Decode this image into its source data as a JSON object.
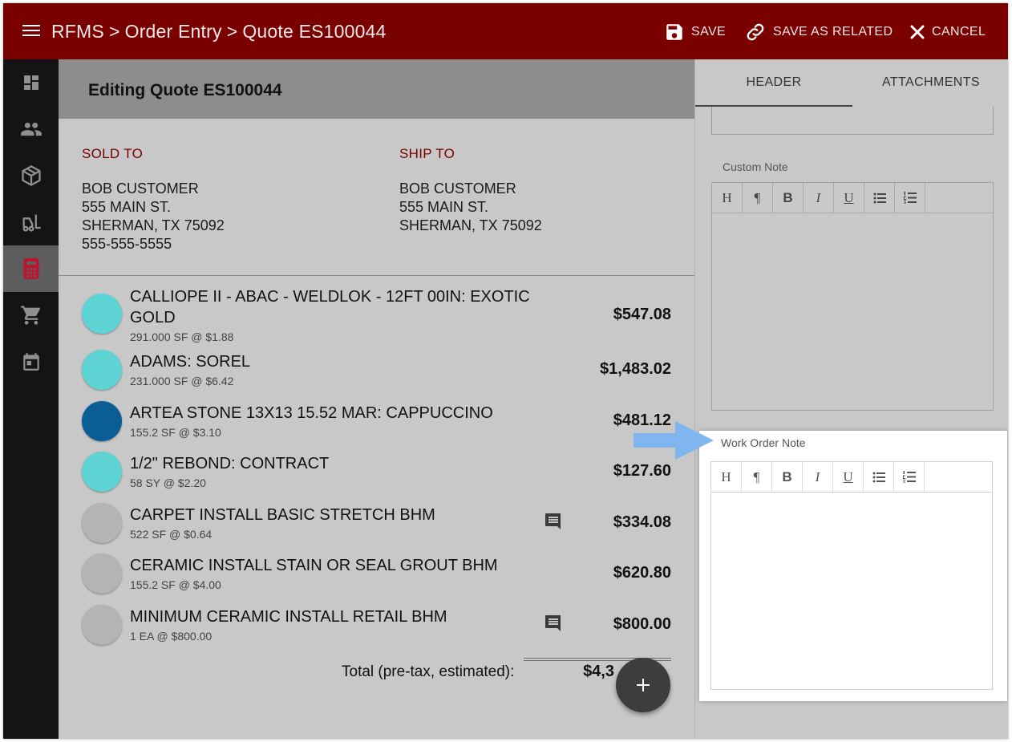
{
  "header": {
    "breadcrumb": [
      "RFMS",
      "Order Entry",
      "Quote ES100044"
    ],
    "breadcrumb_sep": ">",
    "save_label": "SAVE",
    "save_related_label": "SAVE AS RELATED",
    "cancel_label": "CANCEL"
  },
  "sidebar": {
    "items": [
      {
        "icon": "dashboard-icon",
        "active": false
      },
      {
        "icon": "people-icon",
        "active": false
      },
      {
        "icon": "package-icon",
        "active": false
      },
      {
        "icon": "forklift-icon",
        "active": false
      },
      {
        "icon": "calculator-icon",
        "active": true
      },
      {
        "icon": "cart-icon",
        "active": false
      },
      {
        "icon": "calendar-icon",
        "active": false
      }
    ]
  },
  "quote": {
    "title": "Editing Quote ES100044",
    "sold_to_label": "SOLD TO",
    "sold_to": [
      "BOB CUSTOMER",
      "555 MAIN ST.",
      "SHERMAN, TX 75092",
      "555-555-5555"
    ],
    "ship_to_label": "SHIP TO",
    "ship_to": [
      "BOB CUSTOMER",
      "555 MAIN ST.",
      "SHERMAN, TX 75092"
    ],
    "lines": [
      {
        "name": "CALLIOPE II - ABAC - WELDLOK - 12FT 00IN: EXOTIC GOLD",
        "detail": "291.000 SF @ $1.88",
        "price": "$547.08",
        "color": "#5ed3d3",
        "has_note": false
      },
      {
        "name": "ADAMS: SOREL",
        "detail": "231.000 SF @ $6.42",
        "price": "$1,483.02",
        "color": "#5ed3d3",
        "has_note": false
      },
      {
        "name": "ARTEA STONE 13X13 15.52 MAR: CAPPUCCINO",
        "detail": "155.2 SF @ $3.10",
        "price": "$481.12",
        "color": "#0b5d96",
        "has_note": false
      },
      {
        "name": "1/2\" REBOND: CONTRACT",
        "detail": "58 SY @ $2.20",
        "price": "$127.60",
        "color": "#5ed3d3",
        "has_note": false
      },
      {
        "name": "CARPET INSTALL BASIC STRETCH BHM",
        "detail": "522 SF @ $0.64",
        "price": "$334.08",
        "color": "#b4b3b5",
        "has_note": true
      },
      {
        "name": "CERAMIC INSTALL STAIN OR SEAL GROUT BHM",
        "detail": "155.2 SF @ $4.00",
        "price": "$620.80",
        "color": "#b4b3b5",
        "has_note": false
      },
      {
        "name": "MINIMUM CERAMIC INSTALL RETAIL BHM",
        "detail": "1 EA @ $800.00",
        "price": "$800.00",
        "color": "#b4b3b5",
        "has_note": true
      }
    ],
    "total_label": "Total (pre-tax, estimated):",
    "total_value_visible": "$4,3"
  },
  "panel": {
    "tabs": [
      {
        "label": "HEADER",
        "active": true
      },
      {
        "label": "ATTACHMENTS",
        "active": false
      }
    ],
    "custom_note_label": "Custom Note",
    "work_order_note_label": "Work Order Note",
    "toolbar_buttons": [
      "H",
      "¶",
      "B",
      "I",
      "U",
      "bulleted-list-icon",
      "numbered-list-icon"
    ]
  },
  "colors": {
    "brand": "#7a0000",
    "rail": "#141416",
    "highlight_arrow": "#7fb6f0"
  }
}
